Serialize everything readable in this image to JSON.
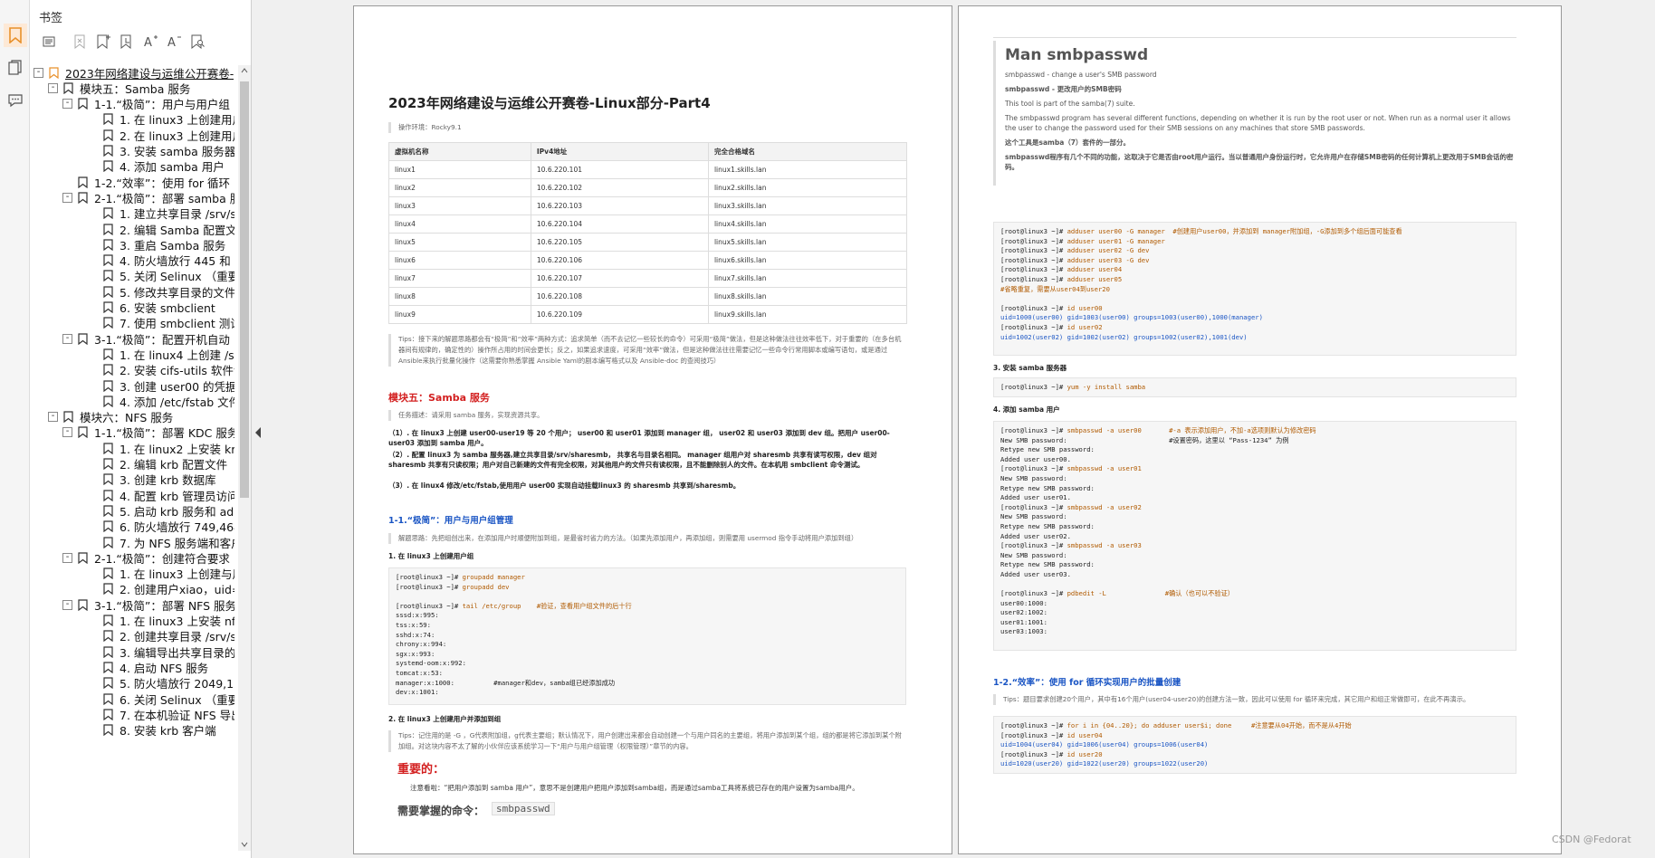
{
  "panel": {
    "title": "书签",
    "tree": [
      {
        "level": 0,
        "label": "2023年网络建设与运维公开赛卷-",
        "exp": "-",
        "bm": "orange",
        "underline": true
      },
      {
        "level": 1,
        "label": "模块五：Samba 服务",
        "exp": "-"
      },
      {
        "level": 2,
        "label": "1-1.“极简”：用户与用户组",
        "exp": "-"
      },
      {
        "level": 3,
        "label": "1. 在 linux3 上创建用户"
      },
      {
        "level": 3,
        "label": "2. 在 linux3 上创建用户"
      },
      {
        "level": 3,
        "label": "3. 安装 samba 服务器"
      },
      {
        "level": 3,
        "label": "4. 添加 samba 用户"
      },
      {
        "level": 2,
        "label": "1-2.“效率”：使用 for 循环"
      },
      {
        "level": 2,
        "label": "2-1.“极简”：部署 samba 服",
        "exp": "-"
      },
      {
        "level": 3,
        "label": "1. 建立共享目录 /srv/sh"
      },
      {
        "level": 3,
        "label": "2. 编辑 Samba 配置文件"
      },
      {
        "level": 3,
        "label": "3. 重启 Samba 服务"
      },
      {
        "level": 3,
        "label": "4. 防火墙放行 445 和 13"
      },
      {
        "level": 3,
        "label": "5. 关闭 Selinux （重要"
      },
      {
        "level": 3,
        "label": "5. 修改共享目录的文件"
      },
      {
        "level": 3,
        "label": "6. 安装 smbclient"
      },
      {
        "level": 3,
        "label": "7. 使用 smbclient 测试"
      },
      {
        "level": 2,
        "label": "3-1.“极简”：配置开机自动",
        "exp": "-"
      },
      {
        "level": 3,
        "label": "1. 在 linux4 上创建 /sha"
      },
      {
        "level": 3,
        "label": "2. 安装 cifs-utils 软件包"
      },
      {
        "level": 3,
        "label": "3. 创建 user00 的凭据文"
      },
      {
        "level": 3,
        "label": "4. 添加 /etc/fstab 文件"
      },
      {
        "level": 1,
        "label": "模块六：NFS 服务",
        "exp": "-"
      },
      {
        "level": 2,
        "label": "1-1.“极简”：部署 KDC 服务",
        "exp": "-"
      },
      {
        "level": 3,
        "label": "1. 在 linux2 上安装 krb 5"
      },
      {
        "level": 3,
        "label": "2. 编辑 krb 配置文件"
      },
      {
        "level": 3,
        "label": "3. 创建 krb 数据库"
      },
      {
        "level": 3,
        "label": "4. 配置 krb 管理员访问"
      },
      {
        "level": 3,
        "label": "5. 启动 krb 服务和 adm"
      },
      {
        "level": 3,
        "label": "6. 防火墙放行 749,464,8"
      },
      {
        "level": 3,
        "label": "7. 为 NFS 服务端和客户"
      },
      {
        "level": 2,
        "label": "2-1.“极简”：创建符合要求",
        "exp": "-"
      },
      {
        "level": 3,
        "label": "1. 在 linux3 上创建与用"
      },
      {
        "level": 3,
        "label": "2. 创建用户xiao，uid=g"
      },
      {
        "level": 2,
        "label": "3-1.“极简”：部署 NFS 服务",
        "exp": "-"
      },
      {
        "level": 3,
        "label": "1. 在 linux3 上安装 nfs-"
      },
      {
        "level": 3,
        "label": "2. 创建共享目录 /srv/sh"
      },
      {
        "level": 3,
        "label": "3. 编辑导出共享目录的"
      },
      {
        "level": 3,
        "label": "4. 启动 NFS 服务"
      },
      {
        "level": 3,
        "label": "5. 防火墙放行 2049,111,"
      },
      {
        "level": 3,
        "label": "6. 关闭 Selinux （重要"
      },
      {
        "level": 3,
        "label": "7. 在本机验证 NFS 导出"
      },
      {
        "level": 3,
        "label": "8. 安装 krb 客户端"
      }
    ]
  },
  "page1": {
    "title": "2023年网络建设与运维公开赛卷-Linux部分-Part4",
    "env": "操作环境：Rocky9.1",
    "table_headers": [
      "虚拟机名称",
      "IPv4地址",
      "完全合格域名"
    ],
    "table_rows": [
      [
        "linux1",
        "10.6.220.101",
        "linux1.skills.lan"
      ],
      [
        "linux2",
        "10.6.220.102",
        "linux2.skills.lan"
      ],
      [
        "linux3",
        "10.6.220.103",
        "linux3.skills.lan"
      ],
      [
        "linux4",
        "10.6.220.104",
        "linux4.skills.lan"
      ],
      [
        "linux5",
        "10.6.220.105",
        "linux5.skills.lan"
      ],
      [
        "linux6",
        "10.6.220.106",
        "linux6.skills.lan"
      ],
      [
        "linux7",
        "10.6.220.107",
        "linux7.skills.lan"
      ],
      [
        "linux8",
        "10.6.220.108",
        "linux8.skills.lan"
      ],
      [
        "linux9",
        "10.6.220.109",
        "linux9.skills.lan"
      ]
    ],
    "tip1": "Tips：接下来的解题思路都会有“极简”和“效率”两种方式：追求简单（而不去记忆一些较长的命令）可采用“极简”做法，但是这种做法往往效率低下，对于重要的（在多台机器间有规律的，确定性的）操作所占用的时间会更长；反之，如果追求速度，可采用“效率”做法，但是这种做法往往需要记忆一些命令行常用脚本或编写语句，或是通过Ansible来执行批量化操作（这需要你熟悉掌握 Ansible Yaml的剧本编写格式以及 Ansible-doc 的查阅技巧）",
    "module5": "模块五：Samba 服务",
    "task_desc": "任务描述：请采用 samba 服务，实现资源共享。",
    "req1": "（1）. 在 linux3 上创建 user00-user19 等 20 个用户； user00 和 user01 添加到 manager 组， user02 和 user03 添加到 dev 组。把用户 user00-user03 添加到 samba 用户。",
    "req2": "（2）. 配置 linux3 为 samba 服务器,建立共享目录/srv/sharesmb， 共享名与目录名相同。 manager 组用户对 sharesmb 共享有读写权限，dev 组对 sharesmb 共享有只读权限；用户对自己新建的文件有完全权限，对其他用户的文件只有读权限，且不能删除别人的文件。在本机用 smbclient 命令测试。",
    "req3": "（3）. 在 linux4 修改/etc/fstab,使用用户 user00 实现自动挂载linux3 的 sharesmb 共享到/sharesmb。",
    "h_1_1": "1-1.“极简”：用户与用户组管理",
    "tip2": "解题思路：先把组创出来，在添加用户时顺便附加到组，是最省时省力的方法。（如果先添加用户，再添加组，则需要用 usermod 指令手动将用户添加到组）",
    "step1": "1. 在 linux3 上创建用户组",
    "code1": [
      "[root@linux3 ~]# groupadd manager",
      "[root@linux3 ~]# groupadd dev",
      "",
      "[root@linux3 ~]# tail /etc/group    #验证，查看用户组文件的后十行",
      "sssd:x:995:",
      "tss:x:59:",
      "sshd:x:74:",
      "chrony:x:994:",
      "sgx:x:993:",
      "systemd-oom:x:992:",
      "tomcat:x:53:",
      "manager:x:1000:          #manager和dev，samba组已经添加成功",
      "dev:x:1001:"
    ],
    "step2": "2. 在 linux3 上创建用户并添加到组",
    "tip3": "Tips：记住用的是 -G ，G代表附加组，g代表主要组；默认情况下，用户创建出来都会自动创建一个与用户同名的主要组，将用户添加到某个组，组的都是将它添加到某个附加组。对这块内容不太了解的小伙伴应该系统学习一下“用户与用户组管理（权限管理）”章节的内容。",
    "important": "重要的：",
    "note": "注意看啦：“把用户添加到 samba 用户”，意思不是创建用户把用户添加到samba组，而是通过samba工具将系统已存在的用户设置为samba用户。",
    "must": "需要掌握的命令：",
    "must_cmd": "smbpasswd"
  },
  "page2": {
    "man_title": "Man smbpasswd",
    "l1": "smbpasswd - change a user's SMB password",
    "l2": "smbpasswd - 更改用户的SMB密码",
    "l3": "This tool is part of the samba(7) suite.",
    "l4": "The smbpasswd program has several different functions, depending on whether it is run by the root user or not. When run as a normal user it allows the user to change the password used for their SMB sessions on any machines that store SMB passwords.",
    "l5": "这个工具是samba（7）套件的一部分。",
    "l6": "smbpasswd程序有几个不同的功能，这取决于它是否由root用户运行。当以普通用户身份运行时，它允许用户在存储SMB密码的任何计算机上更改用于SMB会话的密码。",
    "code_a": [
      "[root@linux3 ~]# adduser user00 -G manager  #创建用户user00，并添加到 manager附加组，-G添加到多个组后面可能查看",
      "[root@linux3 ~]# adduser user01 -G manager",
      "[root@linux3 ~]# adduser user02 -G dev",
      "[root@linux3 ~]# adduser user03 -G dev",
      "[root@linux3 ~]# adduser user04",
      "[root@linux3 ~]# adduser user05",
      "#省略重复，需要从user04到user20",
      "",
      "[root@linux3 ~]# id user00",
      "uid=1000(user00) gid=1003(user00) groups=1003(user00),1000(manager)",
      "[root@linux3 ~]# id user02",
      "uid=1002(user02) gid=1002(user02) groups=1002(user02),1001(dev)"
    ],
    "s3": "3. 安装 samba 服务器",
    "code_b": [
      "[root@linux3 ~]# yum -y install samba"
    ],
    "s4": "4. 添加 samba 用户",
    "code_c": [
      "[root@linux3 ~]# smbpasswd -a user00       #-a 表示添加用户，不加-a选项则默认为修改密码",
      "New SMB password:                          #设置密码，这里以 “Pass-1234” 为例",
      "Retype new SMB password:",
      "Added user user00.",
      "[root@linux3 ~]# smbpasswd -a user01",
      "New SMB password:",
      "Retype new SMB password:",
      "Added user user01.",
      "[root@linux3 ~]# smbpasswd -a user02",
      "New SMB password:",
      "Retype new SMB password:",
      "Added user user02.",
      "[root@linux3 ~]# smbpasswd -a user03",
      "New SMB password:",
      "Retype new SMB password:",
      "Added user user03.",
      "",
      "[root@linux3 ~]# pdbedit -L               #确认（也可以不验证）",
      "user00:1000:",
      "user02:1002:",
      "user01:1001:",
      "user03:1003:"
    ],
    "h_1_2": "1-2.“效率”：使用 for 循环实现用户的批量创建",
    "tip4": "Tips：题目要求创建20个用户，其中有16个用户(user04-user20)的创建方法一致，因此可以使用 for 循环来完成，其它用户和组正常做即可，在此不再演示。",
    "code_d": [
      "[root@linux3 ~]# for i in {04..20}; do adduser user$i; done     #注意要从04开始，而不是从4开始",
      "[root@linux3 ~]# id user04",
      "uid=1004(user04) gid=1006(user04) groups=1006(user04)",
      "[root@linux3 ~]# id user20",
      "uid=1020(user20) gid=1022(user20) groups=1022(user20)"
    ]
  },
  "watermark": "CSDN @Fedorat",
  "colors": {
    "accent_red": "#d32020",
    "accent_blue": "#1a55c4",
    "bookmark_orange": "#e8902a"
  }
}
